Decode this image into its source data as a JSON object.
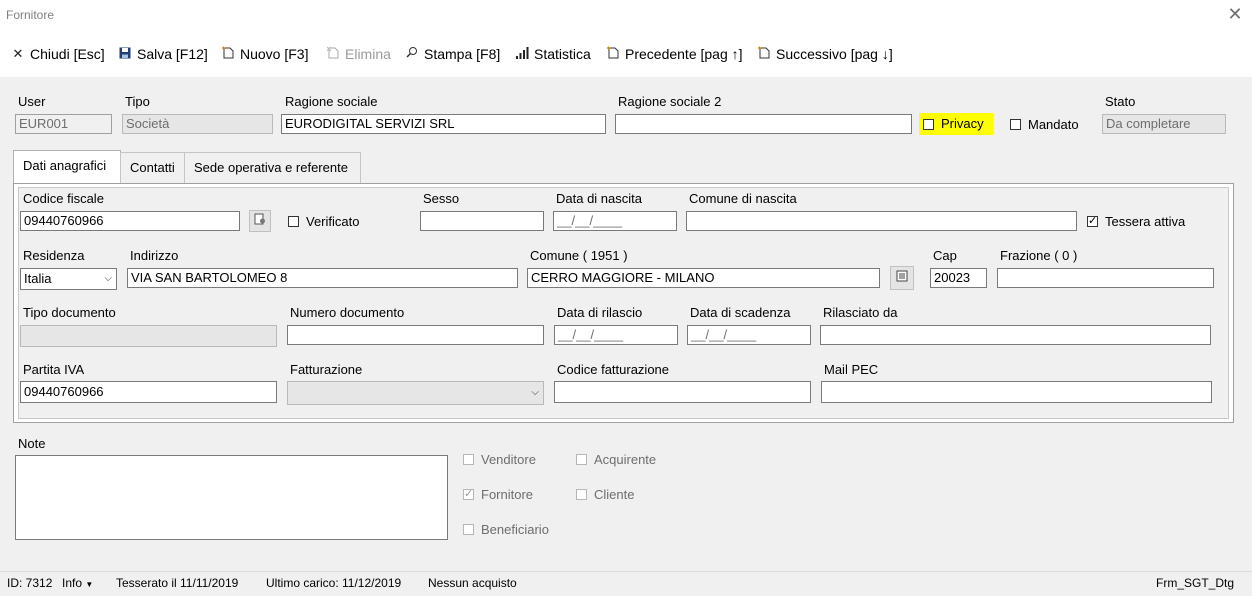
{
  "window": {
    "title": "Fornitore"
  },
  "toolbar": {
    "close": "Chiudi [Esc]",
    "save": "Salva [F12]",
    "new": "Nuovo [F3]",
    "delete": "Elimina",
    "print": "Stampa [F8]",
    "stats": "Statistica",
    "prev": "Precedente [pag ↑]",
    "next": "Successivo [pag ↓]"
  },
  "header": {
    "user_label": "User",
    "user_value": "EUR001",
    "tipo_label": "Tipo",
    "tipo_value": "Società",
    "ragione_label": "Ragione sociale",
    "ragione_value": "EURODIGITAL SERVIZI SRL",
    "ragione2_label": "Ragione sociale 2",
    "ragione2_value": "",
    "privacy_label": "Privacy",
    "privacy_checked": false,
    "mandato_label": "Mandato",
    "mandato_checked": false,
    "stato_label": "Stato",
    "stato_value": "Da completare"
  },
  "tabs": [
    "Dati anagrafici",
    "Contatti",
    "Sede operativa e referente"
  ],
  "form": {
    "cf_label": "Codice fiscale",
    "cf_value": "09440760966",
    "verificato_label": "Verificato",
    "sesso_label": "Sesso",
    "sesso_value": "",
    "nascita_label": "Data di nascita",
    "nascita_value": "__/__/____",
    "comune_nascita_label": "Comune di nascita",
    "comune_nascita_value": "",
    "tessera_label": "Tessera attiva",
    "tessera_checked": true,
    "residenza_label": "Residenza",
    "residenza_value": "Italia",
    "indirizzo_label": "Indirizzo",
    "indirizzo_value": "VIA SAN BARTOLOMEO 8",
    "comune_label": "Comune ( 1951 )",
    "comune_value": "CERRO MAGGIORE - MILANO",
    "cap_label": "Cap",
    "cap_value": "20023",
    "frazione_label": "Frazione ( 0 )",
    "frazione_value": "",
    "tipo_doc_label": "Tipo documento",
    "tipo_doc_value": "",
    "num_doc_label": "Numero documento",
    "num_doc_value": "",
    "rilascio_label": "Data di rilascio",
    "rilascio_value": "__/__/____",
    "scadenza_label": "Data di scadenza",
    "scadenza_value": "__/__/____",
    "rilasciato_label": "Rilasciato da",
    "rilasciato_value": "",
    "piva_label": "Partita IVA",
    "piva_value": "09440760966",
    "fatturazione_label": "Fatturazione",
    "fatturazione_value": "",
    "cod_fatt_label": "Codice fatturazione",
    "cod_fatt_value": "",
    "pec_label": "Mail PEC",
    "pec_value": ""
  },
  "notes": {
    "label": "Note",
    "value": ""
  },
  "roles": {
    "venditore": "Venditore",
    "acquirente": "Acquirente",
    "fornitore": "Fornitore",
    "cliente": "Cliente",
    "beneficiario": "Beneficiario",
    "fornitore_checked": true
  },
  "status": {
    "id": "ID: 7312",
    "info": "Info",
    "tesserato": "Tesserato il 11/11/2019",
    "ultimo_carico": "Ultimo carico: 11/12/2019",
    "acquisti": "Nessun acquisto",
    "form_name": "Frm_SGT_Dtg"
  },
  "icons": {
    "close": "close-icon",
    "save": "floppy-icon",
    "new": "new-document-icon",
    "delete": "delete-icon",
    "print": "search-print-icon",
    "stats": "bar-chart-icon",
    "prev": "previous-page-icon",
    "next": "next-page-icon"
  }
}
